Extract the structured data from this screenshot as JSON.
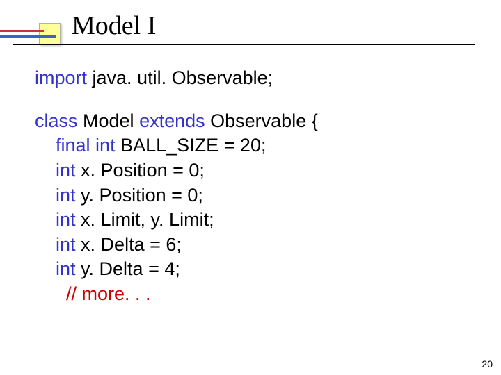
{
  "title": "Model I",
  "page_number": "20",
  "code": {
    "l1": {
      "a": "import",
      "b": " java. util. Observable;"
    },
    "l2": {
      "a": "class",
      "b": " Model ",
      "c": "extends",
      "d": " Observable {"
    },
    "l3": {
      "a": "    ",
      "b": "final int",
      "c": " BALL_SIZE = 20;"
    },
    "l4": {
      "a": "    ",
      "b": "int",
      "c": " x. Position = 0;"
    },
    "l5": {
      "a": "    ",
      "b": "int",
      "c": " y. Position = 0;"
    },
    "l6": {
      "a": "    ",
      "b": "int",
      "c": " x. Limit, y. Limit;"
    },
    "l7": {
      "a": "    ",
      "b": "int",
      "c": " x. Delta = 6;"
    },
    "l8": {
      "a": "    ",
      "b": "int",
      "c": " y. Delta = 4;"
    },
    "l9": {
      "a": "      ",
      "b": "// more. . ."
    }
  }
}
